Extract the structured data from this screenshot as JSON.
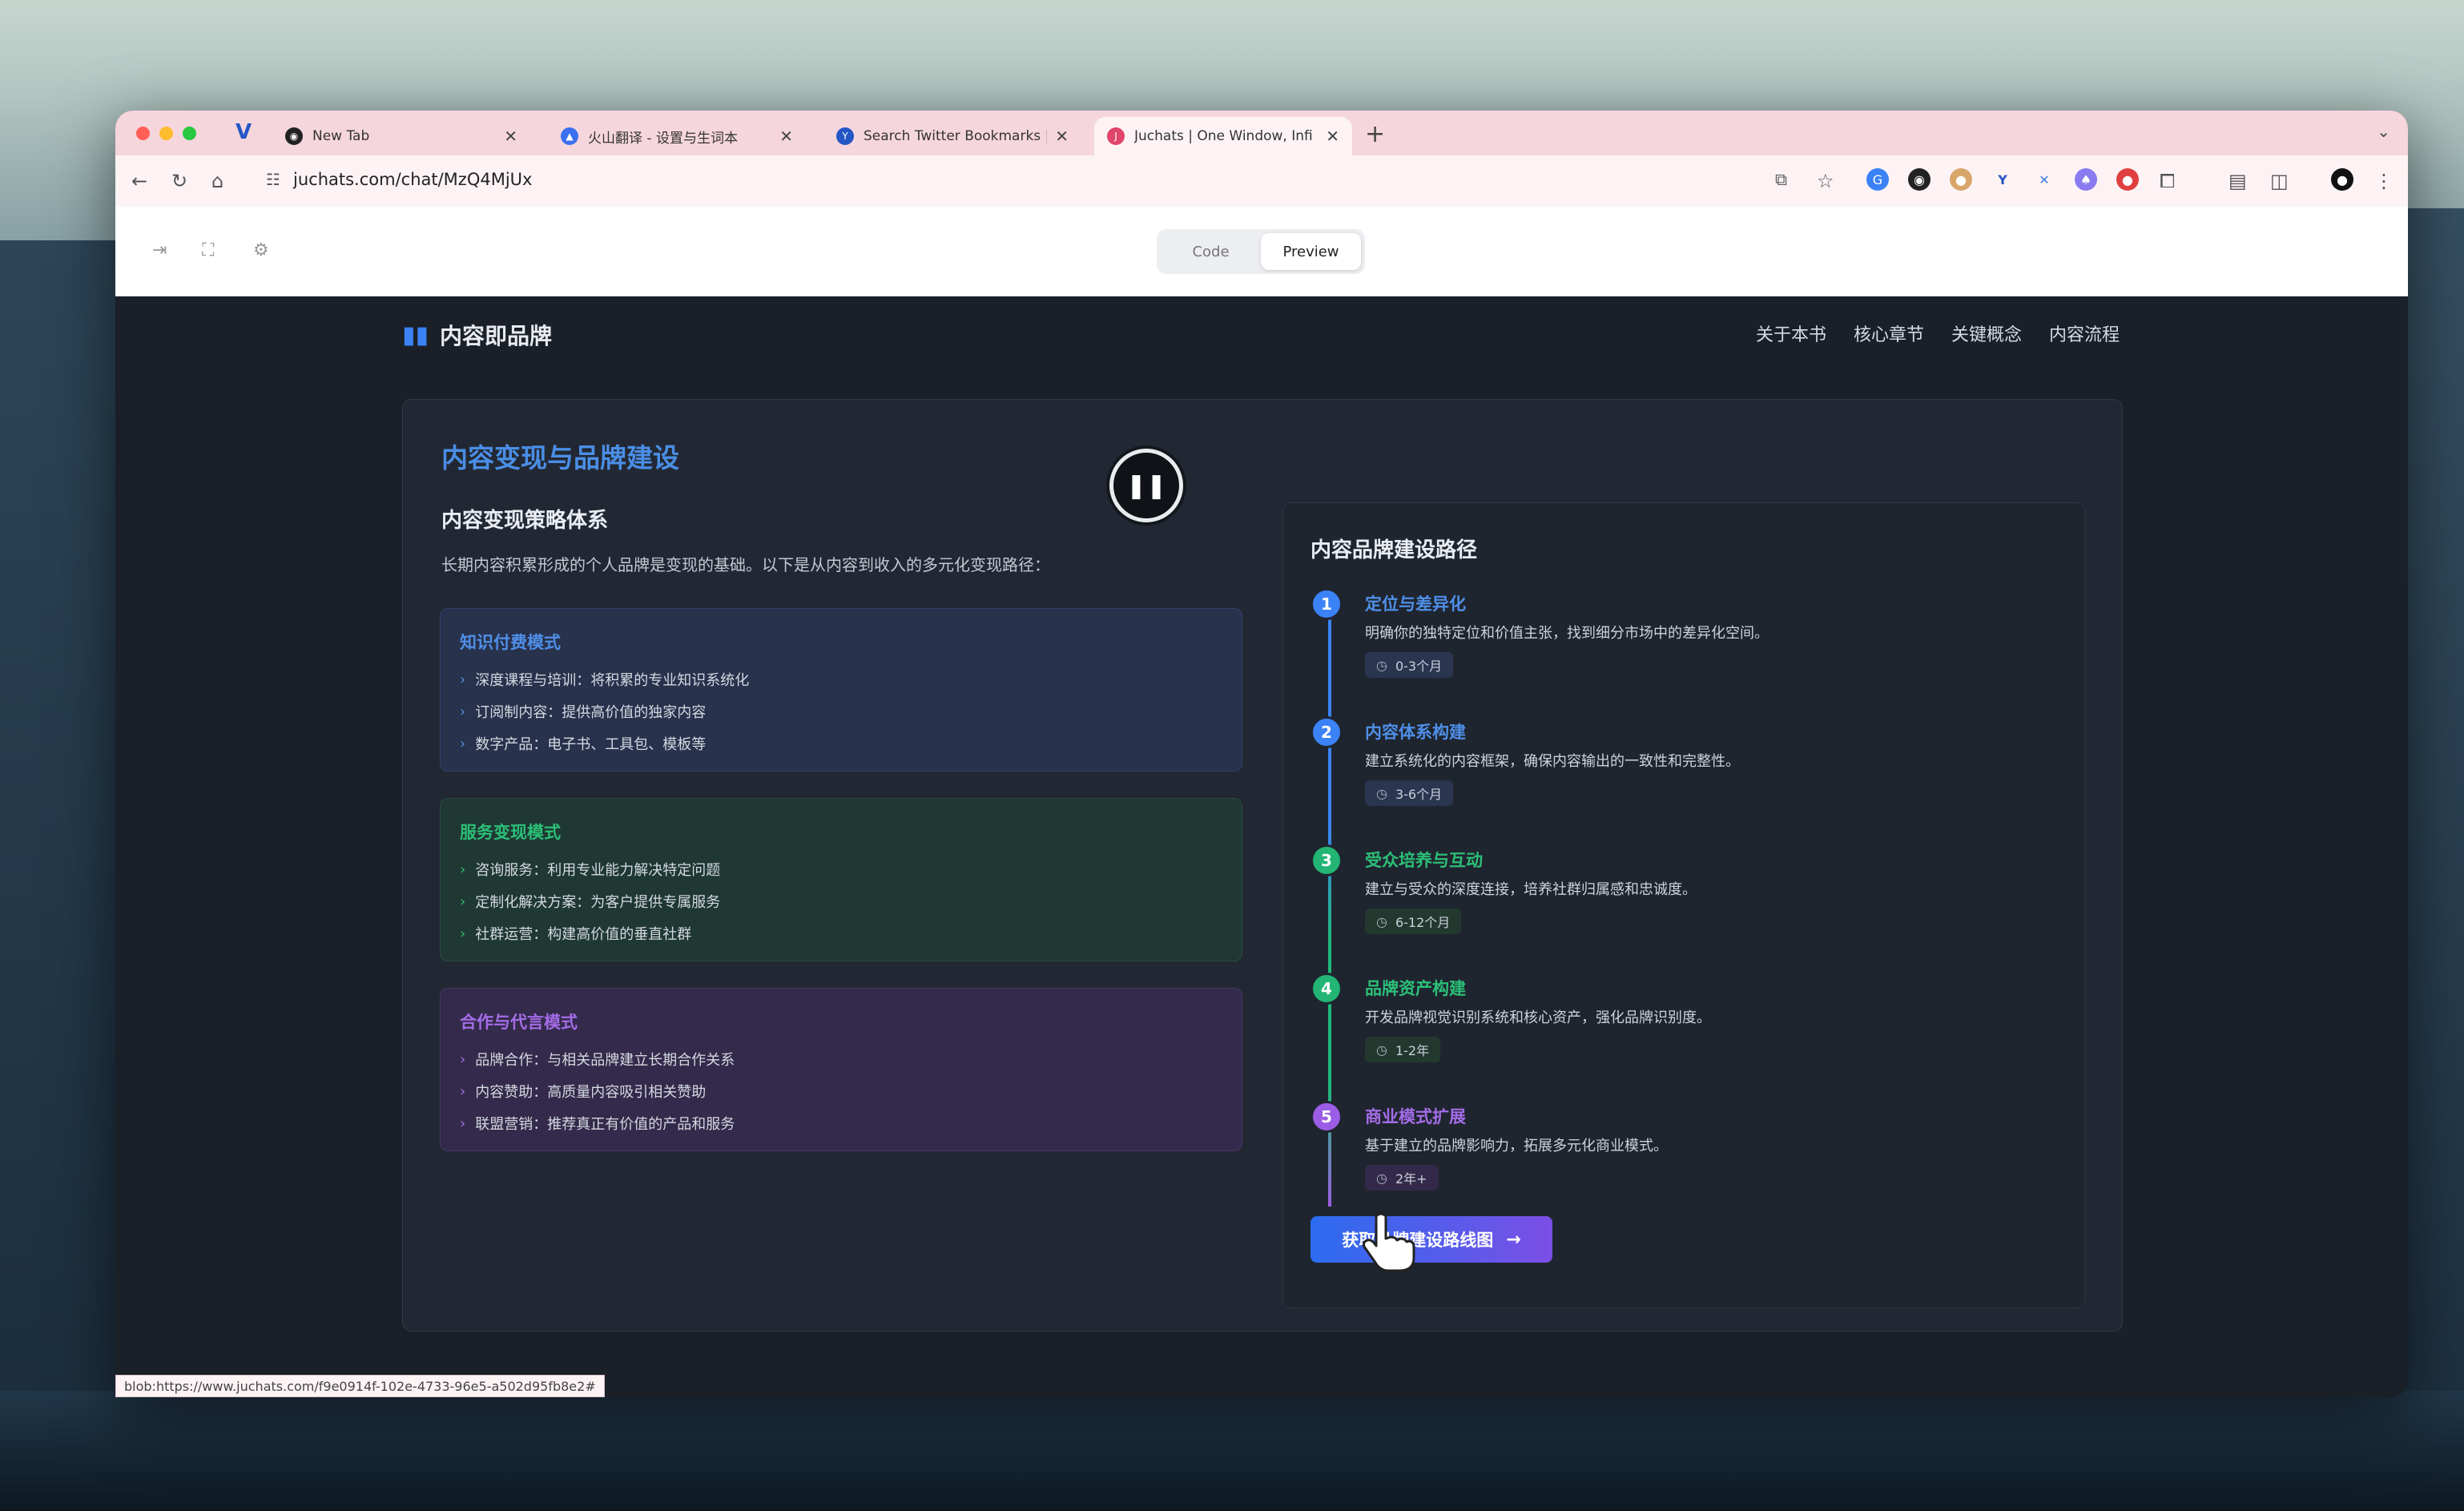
{
  "browser": {
    "tabs": [
      {
        "title": "New Tab",
        "favicon_color": "#222222",
        "icon": "new-tab-icon"
      },
      {
        "title": "火山翻译 - 设置与生词本",
        "favicon_color": "#3a6ff0",
        "icon": "volcano-translate-icon"
      },
      {
        "title": "Search Twitter Bookmarks | A",
        "favicon_color": "#2457c5",
        "icon": "twitter-search-icon"
      },
      {
        "title": "Juchats | One Window, Infi",
        "favicon_color": "#e0446a",
        "icon": "juchats-icon"
      }
    ],
    "active_tab": 3,
    "url": "juchats.com/chat/MzQ4MjUx",
    "status_url": "blob:https://www.juchats.com/f9e0914f-102e-4733-96e5-a502d95fb8e2#"
  },
  "appbar": {
    "code_label": "Code",
    "preview_label": "Preview",
    "active": "Preview"
  },
  "site": {
    "brand": "内容即品牌",
    "brand_icon": "book-icon",
    "nav": [
      "关于本书",
      "核心章节",
      "关键概念",
      "内容流程"
    ]
  },
  "section": {
    "title": "内容变现与品牌建设",
    "subtitle": "内容变现策略体系",
    "lead": "长期内容积累形成的个人品牌是变现的基础。以下是从内容到收入的多元化变现路径：",
    "modes": [
      {
        "title": "知识付费模式",
        "color": "#4f8fe8",
        "items": [
          "深度课程与培训：将积累的专业知识系统化",
          "订阅制内容：提供高价值的独家内容",
          "数字产品：电子书、工具包、模板等"
        ]
      },
      {
        "title": "服务变现模式",
        "color": "#2bbf77",
        "items": [
          "咨询服务：利用专业能力解决特定问题",
          "定制化解决方案：为客户提供专属服务",
          "社群运营：构建高价值的垂直社群"
        ]
      },
      {
        "title": "合作与代言模式",
        "color": "#a46ce8",
        "items": [
          "品牌合作：与相关品牌建立长期合作关系",
          "内容赞助：高质量内容吸引相关赞助",
          "联盟营销：推荐真正有价值的产品和服务"
        ]
      }
    ]
  },
  "roadmap": {
    "title": "内容品牌建设路径",
    "steps": [
      {
        "num": "1",
        "title": "定位与差异化",
        "desc": "明确你的独特定位和价值主张，找到细分市场中的差异化空间。",
        "time": "0-3个月",
        "color": "#3b82f6"
      },
      {
        "num": "2",
        "title": "内容体系构建",
        "desc": "建立系统化的内容框架，确保内容输出的一致性和完整性。",
        "time": "3-6个月",
        "color": "#3b82f6"
      },
      {
        "num": "3",
        "title": "受众培养与互动",
        "desc": "建立与受众的深度连接，培养社群归属感和忠诚度。",
        "time": "6-12个月",
        "color": "#22b573"
      },
      {
        "num": "4",
        "title": "品牌资产构建",
        "desc": "开发品牌视觉识别系统和核心资产，强化品牌识别度。",
        "time": "1-2年",
        "color": "#22b573"
      },
      {
        "num": "5",
        "title": "商业模式扩展",
        "desc": "基于建立的品牌影响力，拓展多元化商业模式。",
        "time": "2年+",
        "color": "#9b5de5"
      }
    ],
    "cta": "获取品牌建设路线图"
  }
}
